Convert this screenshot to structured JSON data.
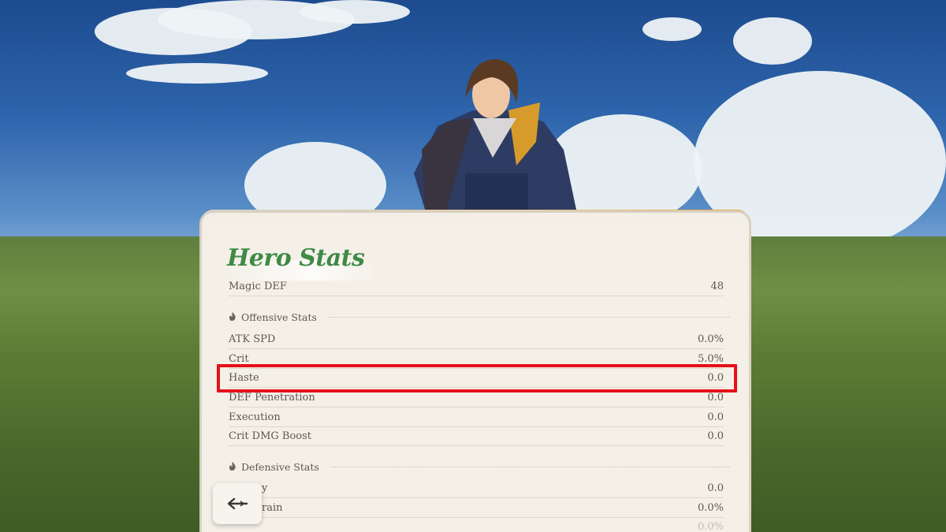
{
  "panel": {
    "title": "Hero Stats"
  },
  "top_row": {
    "label": "Magic DEF",
    "value": "48"
  },
  "offensive": {
    "heading": "Offensive Stats",
    "rows": [
      {
        "label": "ATK SPD",
        "value": "0.0%"
      },
      {
        "label": "Crit",
        "value": "5.0%"
      },
      {
        "label": "Haste",
        "value": "0.0"
      },
      {
        "label": "DEF Penetration",
        "value": "0.0"
      },
      {
        "label": "Execution",
        "value": "0.0"
      },
      {
        "label": "Crit DMG Boost",
        "value": "0.0"
      }
    ]
  },
  "defensive": {
    "heading": "Defensive Stats",
    "rows": [
      {
        "label": "y",
        "value": "0.0"
      },
      {
        "label": "rain",
        "value": "0.0%"
      },
      {
        "label": "",
        "value": "0.0%"
      }
    ]
  },
  "colors": {
    "title_green": "#3f8a45",
    "highlight_red": "#e5101a",
    "panel_bg": "#f4f0e8",
    "accent_orange": "#f0a640"
  },
  "icons": {
    "section": "flame-icon",
    "back": "arrow-left-icon"
  }
}
